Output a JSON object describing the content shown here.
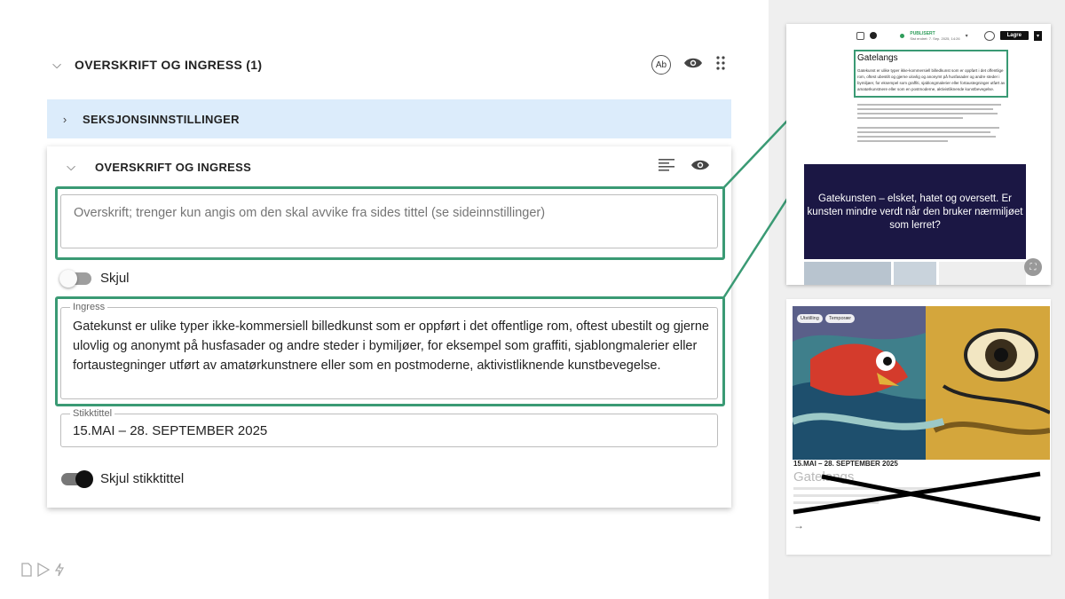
{
  "colors": {
    "highlight": "#3a9a74",
    "settings_bar_bg": "#dcecfb",
    "right_panel_bg": "#efefef",
    "banner_bg": "#1b1744",
    "published_green": "#2e9d5a"
  },
  "outer_section": {
    "title": "OVERSKRIFT OG INGRESS (1)",
    "icons": [
      "chevron-down-icon",
      "ab-icon",
      "eye-icon",
      "drag-handle-icon"
    ],
    "ab_label": "Ab"
  },
  "settings_bar": {
    "title": "SEKSJONSINNSTILLINGER",
    "icon": "chevron-right-icon"
  },
  "card": {
    "title": "OVERSKRIFT OG INGRESS",
    "icons": [
      "chevron-down-icon",
      "align-left-icon",
      "eye-icon"
    ],
    "heading_field": {
      "placeholder": "Overskrift; trenger kun angis om den skal avvike fra sides tittel (se sideinnstillinger)",
      "value": ""
    },
    "hide_toggle": {
      "label": "Skjul",
      "checked": false
    },
    "ingress_field": {
      "label": "Ingress",
      "value": "Gatekunst er ulike typer ikke-kommersiell billedkunst som er oppført i det offentlige rom, oftest ubestilt og gjerne ulovlig og anonymt på husfasader og andre steder i bymiljøer, for eksempel som graffiti, sjablongmalerier eller fortaustegninger utført av amatørkunstnere eller som en postmoderne, aktivistliknende kunstbevegelse."
    },
    "stikktittel_field": {
      "label": "Stikktittel",
      "value": "15.MAI – 28. SEPTEMBER 2025"
    },
    "hide_stikktittel_toggle": {
      "label": "Skjul stikktittel",
      "checked": true
    }
  },
  "preview_page": {
    "toolbar": {
      "status": "PUBLISERT",
      "status_detail": "Sist endret: 7. Sep. 2025, 14:26",
      "save_label": "Lagre",
      "icons": [
        "file-icon",
        "user-icon",
        "status-dot-icon",
        "preview-icon",
        "dropdown-caret-icon"
      ]
    },
    "title": "Gatelangs",
    "intro": "Gatekunst er ulike typer ikke-kommersiell billedkunst som er oppført i det offentlige rom, oftest ubestilt og gjerne ulovlig og anonymt på husfasader og andre steder i bymiljøer, for eksempel som graffiti, sjablongmalerier eller fortaustegninger utført av amatørkunstnere eller som en postmoderne, aktivistliknende kunstbevegelse.",
    "banner_text": "Gatekunsten – elsket, hatet og oversett. Er kunsten mindre verdt når den bruker nærmiljøet som lerret?",
    "expand_icon": "expand-icon"
  },
  "preview_card": {
    "tags": [
      "Utstilling",
      "Temporær"
    ],
    "date": "15.MAI – 28. SEPTEMBER 2025",
    "title": "Gatelangs",
    "arrow": "→",
    "crossed_out": true
  },
  "bottom_icons": [
    "file-icon",
    "play-icon",
    "lightning-icon"
  ]
}
